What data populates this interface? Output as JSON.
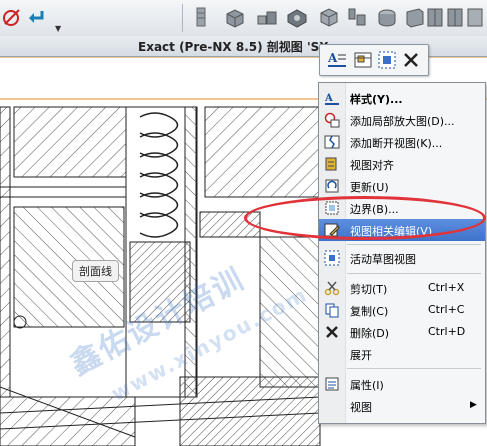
{
  "toolbar": {
    "icons": [
      "no-symbol-icon",
      "enter-arrow-icon",
      "bracket-icon",
      "block-icon",
      "assembly-icon",
      "chamfer-icon",
      "cube-icon",
      "flange-icon",
      "tube-icon",
      "box-icon",
      "book-icon",
      "book-icon",
      "book-icon",
      "sheet-icon"
    ]
  },
  "window": {
    "title": "Exact (Pre-NX 8.5) 剖视图 'SX"
  },
  "canvas": {
    "tooltip": "剖面线",
    "watermark_cn": "鑫佑设计培训",
    "watermark_url": "www.xinyou.com"
  },
  "mini_toolbar": {
    "icons": [
      "style-icon",
      "add-view-icon",
      "active-sketch-icon",
      "close-icon"
    ]
  },
  "menu": {
    "items": [
      {
        "label": "样式(Y)...",
        "shortcut": "",
        "icon": "style-icon"
      },
      {
        "label": "添加局部放大图(D)...",
        "shortcut": "",
        "icon": "detail-view-icon"
      },
      {
        "label": "添加断开视图(K)...",
        "shortcut": "",
        "icon": "break-view-icon"
      },
      {
        "label": "视图对齐",
        "shortcut": "",
        "icon": "align-icon"
      },
      {
        "label": "更新(U)",
        "shortcut": "",
        "icon": "update-icon"
      },
      {
        "label": "边界(B)...",
        "shortcut": "",
        "icon": "boundary-icon"
      },
      {
        "label": "视图相关编辑(V)...",
        "shortcut": "",
        "icon": "view-edit-icon"
      },
      {
        "label": "活动草图视图",
        "shortcut": "",
        "icon": "active-sketch-icon"
      },
      {
        "label": "剪切(T)",
        "shortcut": "Ctrl+X",
        "icon": "scissors-icon"
      },
      {
        "label": "复制(C)",
        "shortcut": "Ctrl+C",
        "icon": "copy-icon"
      },
      {
        "label": "删除(D)",
        "shortcut": "Ctrl+D",
        "icon": "delete-icon"
      },
      {
        "label": "展开",
        "shortcut": "",
        "icon": ""
      },
      {
        "label": "属性(I)",
        "shortcut": "",
        "icon": "properties-icon"
      },
      {
        "label": "视图",
        "shortcut": "",
        "icon": ""
      }
    ]
  },
  "colors": {
    "highlight": "#3f72c9",
    "annotation": "#e0333a"
  }
}
